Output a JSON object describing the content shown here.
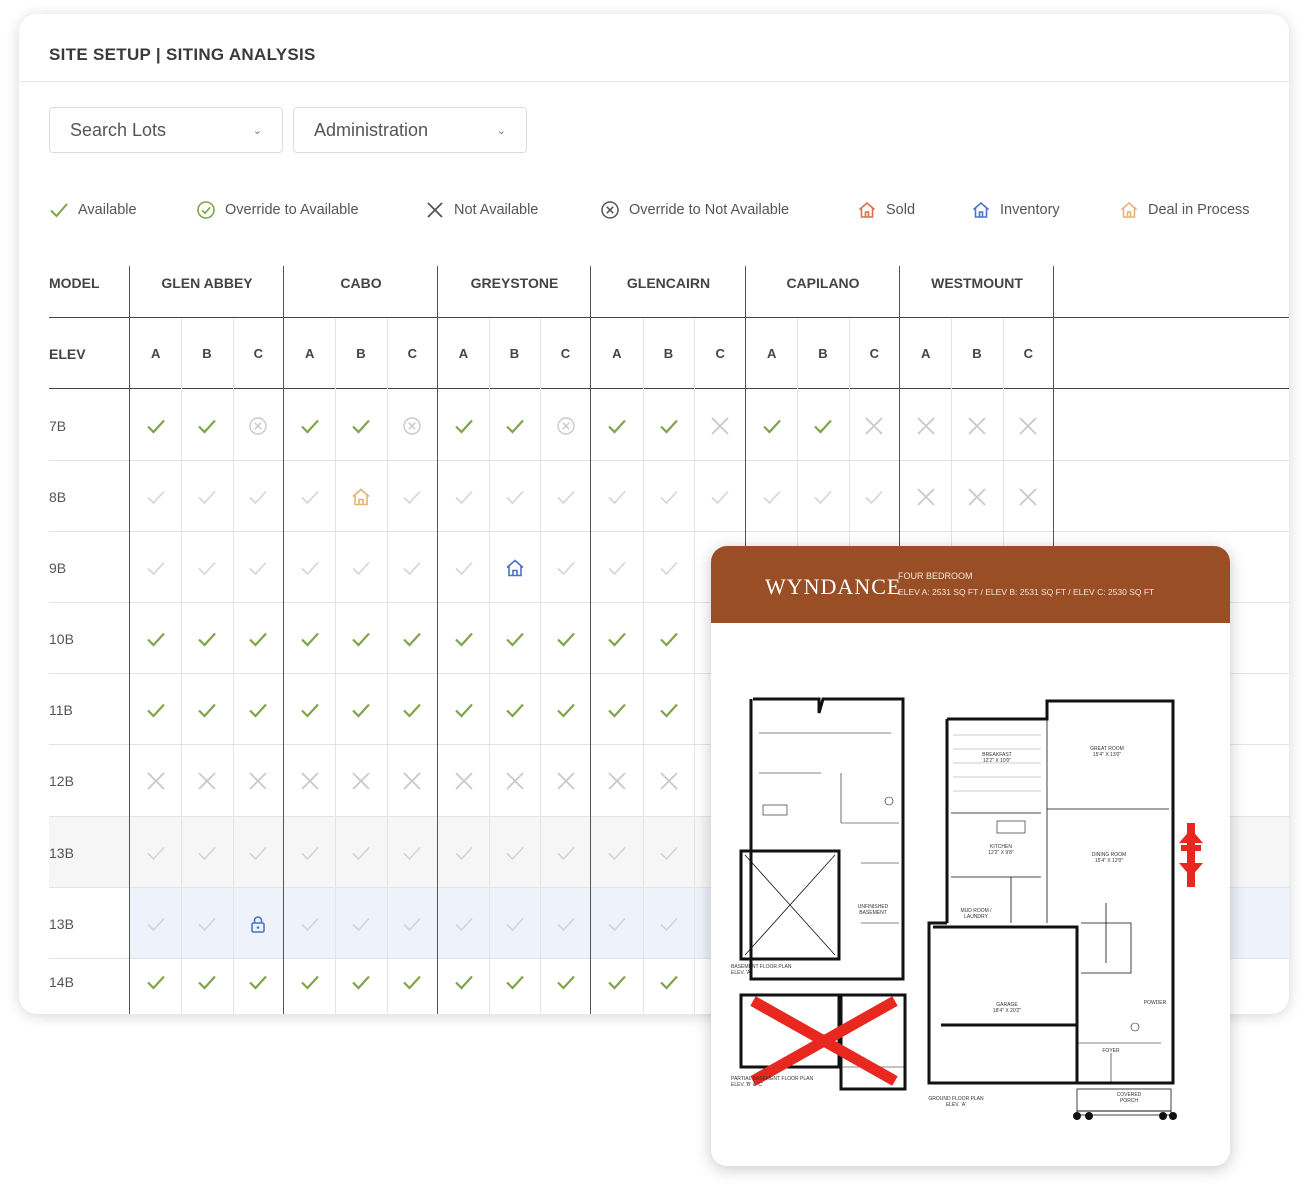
{
  "header": {
    "title": "SITE SETUP | SITING ANALYSIS"
  },
  "filters": {
    "search_lots": "Search Lots",
    "administration": "Administration"
  },
  "legend": [
    {
      "icon": "check-icon",
      "label": "Available"
    },
    {
      "icon": "circle-check-icon",
      "label": "Override to Available"
    },
    {
      "icon": "x-icon",
      "label": "Not Available"
    },
    {
      "icon": "circle-x-icon",
      "label": "Override to Not Available"
    },
    {
      "icon": "house-sold-icon",
      "label": "Sold"
    },
    {
      "icon": "house-inventory-icon",
      "label": "Inventory"
    },
    {
      "icon": "house-deal-icon",
      "label": "Deal in Process"
    }
  ],
  "colors": {
    "available": "#7fa44b",
    "muted": "#d4d4d4",
    "not_available": "#c9c9c9",
    "sold": "#e06b4b",
    "inventory": "#4a73c9",
    "deal": "#e6b273",
    "popup_header": "#9a4e26"
  },
  "table": {
    "model_label": "MODEL",
    "elev_label": "ELEV",
    "models": [
      "GLEN ABBEY",
      "CABO",
      "GREYSTONE",
      "GLENCAIRN",
      "CAPILANO",
      "WESTMOUNT"
    ],
    "elevations": [
      "A",
      "B",
      "C"
    ],
    "rows": [
      {
        "label": "7B",
        "cells": [
          "c",
          "c",
          "ox",
          "c",
          "c",
          "ox",
          "c",
          "c",
          "ox",
          "c",
          "c",
          "x",
          "c",
          "c",
          "x",
          "x",
          "x",
          "x"
        ]
      },
      {
        "label": "8B",
        "cells": [
          "m",
          "m",
          "m",
          "m",
          "deal",
          "m",
          "m",
          "m",
          "m",
          "m",
          "m",
          "m",
          "m",
          "m",
          "m",
          "x",
          "x",
          "x"
        ]
      },
      {
        "label": "9B",
        "cells": [
          "m",
          "m",
          "m",
          "m",
          "m",
          "m",
          "m",
          "inv",
          "m",
          "m",
          "m",
          "m",
          "m",
          "m",
          "m",
          "m",
          "m",
          "m"
        ]
      },
      {
        "label": "10B",
        "cells": [
          "c",
          "c",
          "c",
          "c",
          "c",
          "c",
          "c",
          "c",
          "c",
          "c",
          "c",
          "c",
          "c",
          "c",
          "c",
          "c",
          "c",
          "c"
        ]
      },
      {
        "label": "11B",
        "cells": [
          "c",
          "c",
          "c",
          "c",
          "c",
          "c",
          "c",
          "c",
          "c",
          "c",
          "c",
          "c",
          "c",
          "c",
          "c",
          "c",
          "c",
          "c"
        ]
      },
      {
        "label": "12B",
        "cells": [
          "x",
          "x",
          "x",
          "x",
          "x",
          "x",
          "x",
          "x",
          "x",
          "x",
          "x",
          "x",
          "x",
          "x",
          "x",
          "x",
          "x",
          "x"
        ]
      },
      {
        "label": "13B",
        "cells": [
          "m",
          "m",
          "m",
          "m",
          "m",
          "m",
          "m",
          "m",
          "m",
          "m",
          "m",
          "m",
          "m",
          "m",
          "m",
          "m",
          "m",
          "m"
        ]
      },
      {
        "label": "13B",
        "cells": [
          "m",
          "m",
          "lock",
          "m",
          "m",
          "m",
          "m",
          "m",
          "m",
          "m",
          "m",
          "m",
          "m",
          "m",
          "m",
          "m",
          "m",
          "m"
        ]
      },
      {
        "label": "14B",
        "cells": [
          "c",
          "c",
          "c",
          "c",
          "c",
          "c",
          "c",
          "c",
          "c",
          "c",
          "c",
          "c",
          "c",
          "c",
          "c",
          "c",
          "c",
          "c"
        ]
      }
    ]
  },
  "popup": {
    "name": "WYNDANCE",
    "bedrooms": "FOUR BEDROOM",
    "sqft": "ELEV A: 2531 SQ FT  /  ELEV B: 2531 SQ FT  /  ELEV C: 2530 SQ FT",
    "plan_labels": {
      "basement": "BASEMENT FLOOR PLAN",
      "basement_elev": "ELEV. 'A'",
      "partial_basement": "PARTIAL BASEMENT FLOOR PLAN",
      "partial_basement_elev": "ELEV. 'B' & 'C'",
      "ground": "GROUND FLOOR PLAN",
      "ground_elev": "ELEV. 'A'",
      "great_room": "GREAT ROOM",
      "great_room_size": "15'4\" X 13'0\"",
      "breakfast": "BREAKFAST",
      "breakfast_size": "12'2\" X 10'0\"",
      "kitchen": "KITCHEN",
      "kitchen_size": "12'2\" X 9'8\"",
      "dining_room": "DINING ROOM",
      "dining_room_size": "15'4\" X 12'0\"",
      "mud_room": "MUD ROOM / LAUNDRY",
      "garage": "GARAGE",
      "garage_size": "18'4\" X 20'2\"",
      "foyer": "FOYER",
      "powder": "POWDER",
      "covered_porch": "COVERED PORCH",
      "unfinished": "UNFINISHED BASEMENT"
    }
  }
}
